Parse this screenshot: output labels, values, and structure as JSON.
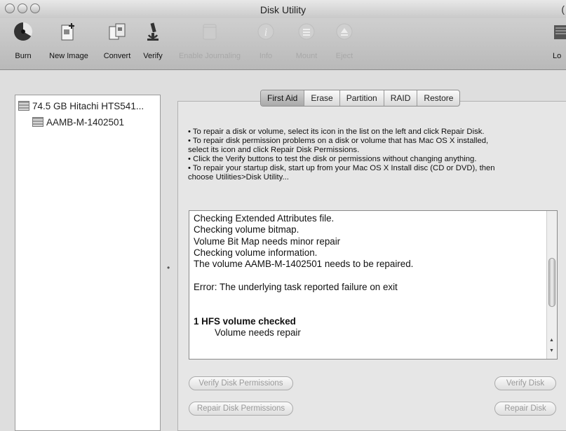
{
  "window": {
    "title": "Disk Utility",
    "title_right": "("
  },
  "toolbar": {
    "items": [
      {
        "label": "Burn",
        "icon": "burn-icon",
        "enabled": true
      },
      {
        "label": "New Image",
        "icon": "new-image-icon",
        "enabled": true
      },
      {
        "label": "Convert",
        "icon": "convert-icon",
        "enabled": true
      },
      {
        "label": "Verify",
        "icon": "microscope-icon",
        "enabled": true
      },
      {
        "label": "Enable Journaling",
        "icon": "journal-icon",
        "enabled": false
      },
      {
        "label": "Info",
        "icon": "info-icon",
        "enabled": false
      },
      {
        "label": "Mount",
        "icon": "mount-icon",
        "enabled": false
      },
      {
        "label": "Eject",
        "icon": "eject-icon",
        "enabled": false
      }
    ],
    "right_label": "Lo"
  },
  "sidebar": {
    "disks": [
      {
        "label": "74.5 GB Hitachi HTS541...",
        "indent": false
      },
      {
        "label": "AAMB-M-1402501",
        "indent": true
      }
    ]
  },
  "tabs": [
    "First Aid",
    "Erase",
    "Partition",
    "RAID",
    "Restore"
  ],
  "active_tab": "First Aid",
  "instructions": [
    "• To repair a disk or volume, select its icon in the list on the left and click Repair Disk.",
    "• To repair disk permission problems on a disk or volume that has Mac OS X installed,",
    "select its icon and click Repair Disk Permissions.",
    "• Click the Verify buttons to test the disk or permissions without changing anything.",
    "• To repair your startup disk, start up from your Mac OS X Install disc (CD or DVD), then",
    "choose Utilities>Disk Utility..."
  ],
  "log": {
    "lines": [
      {
        "text": "Checking Extended Attributes file.",
        "style": "normal"
      },
      {
        "text": "Checking volume bitmap.",
        "style": "normal"
      },
      {
        "text": "Volume Bit Map needs minor repair",
        "style": "normal"
      },
      {
        "text": "Checking volume information.",
        "style": "normal"
      },
      {
        "text": "The volume AAMB-M-1402501 needs to be repaired.",
        "style": "normal"
      },
      {
        "text": "",
        "style": "normal"
      },
      {
        "text": "Error: The underlying task reported failure on exit",
        "style": "normal"
      },
      {
        "text": "",
        "style": "normal"
      },
      {
        "text": "",
        "style": "normal"
      },
      {
        "text": "1 HFS volume checked",
        "style": "bold"
      },
      {
        "text": "Volume needs repair",
        "style": "indent"
      }
    ]
  },
  "buttons": {
    "verify_permissions": "Verify Disk Permissions",
    "repair_permissions": "Repair Disk Permissions",
    "verify_disk": "Verify Disk",
    "repair_disk": "Repair Disk"
  }
}
